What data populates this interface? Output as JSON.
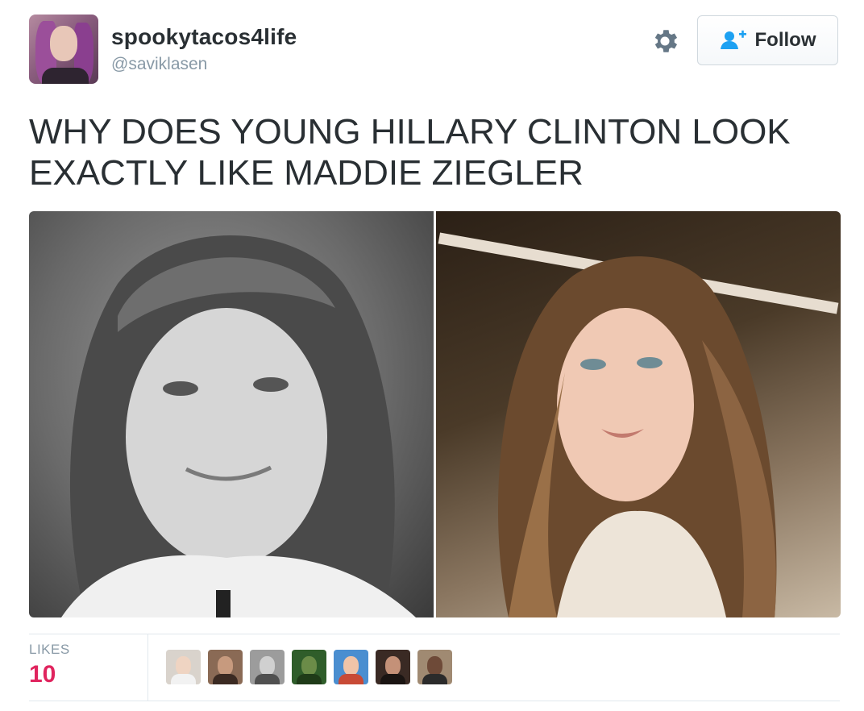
{
  "header": {
    "display_name": "spookytacos4life",
    "handle": "@saviklasen",
    "follow_label": "Follow"
  },
  "tweet": {
    "text": "WHY DOES YOUNG HILLARY CLINTON LOOK EXACTLY LIKE MADDIE ZIEGLER"
  },
  "stats": {
    "likes_label": "LIKES",
    "likes_count": "10"
  },
  "likers": [
    {
      "icon": "liker-avatar"
    },
    {
      "icon": "liker-avatar"
    },
    {
      "icon": "liker-avatar"
    },
    {
      "icon": "liker-avatar"
    },
    {
      "icon": "liker-avatar"
    },
    {
      "icon": "liker-avatar"
    },
    {
      "icon": "liker-avatar"
    }
  ],
  "colors": {
    "accent": "#1da1f2",
    "likes": "#e0245e",
    "muted": "#8899a6",
    "text": "#292f33"
  }
}
